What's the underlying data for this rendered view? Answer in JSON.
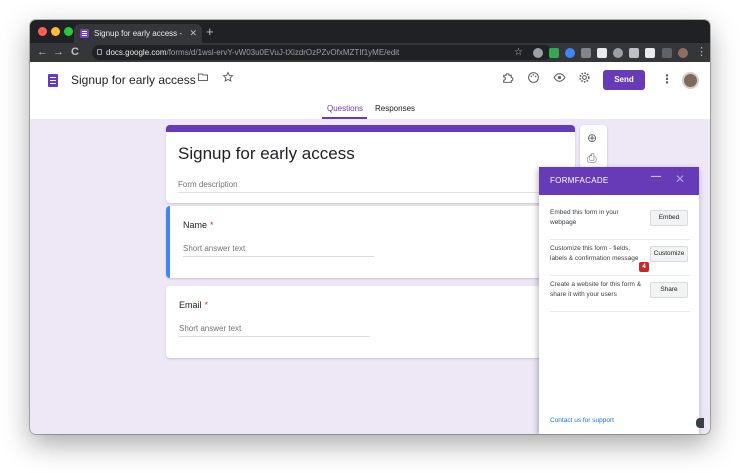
{
  "browser": {
    "tab_title": "Signup for early access - Google",
    "tab_close": "✕",
    "new_tab": "+",
    "nav_back": "←",
    "nav_forward": "→",
    "nav_reload": "C",
    "url_host": "docs.google.com",
    "url_path": "/forms/d/1wsl-ervY-vW03u0EVuJ-tXizdrOzPZvOfxMZTIf1yME/edit",
    "bookmark_star": "☆",
    "menu": "⋮"
  },
  "header": {
    "doc_title": "Signup for early access",
    "send_label": "Send",
    "more_menu": "⋮"
  },
  "form_tabs": {
    "questions": "Questions",
    "responses": "Responses"
  },
  "form": {
    "title": "Signup for early access",
    "description_placeholder": "Form description",
    "questions": [
      {
        "label": "Name",
        "required": "*",
        "placeholder": "Short answer text"
      },
      {
        "label": "Email",
        "required": "*",
        "placeholder": "Short answer text"
      }
    ]
  },
  "side_toolbar": {
    "add": "⊕",
    "import": "⎙"
  },
  "formfacade": {
    "title": "FORMFACADE",
    "minimize": "—",
    "close": "✕",
    "rows": [
      {
        "text": "Embed this form in your webpage",
        "button": "Embed"
      },
      {
        "text": "Customize this form - fields, labels & confirmation message",
        "button": "Customize",
        "badge": "4"
      },
      {
        "text": "Create a website for this form & share it with your users",
        "button": "Share"
      }
    ],
    "support_link": "Contact us for support"
  },
  "colors": {
    "accent": "#673ab7",
    "active_question": "#4285f4",
    "required": "#d93025",
    "badge": "#c62828"
  }
}
